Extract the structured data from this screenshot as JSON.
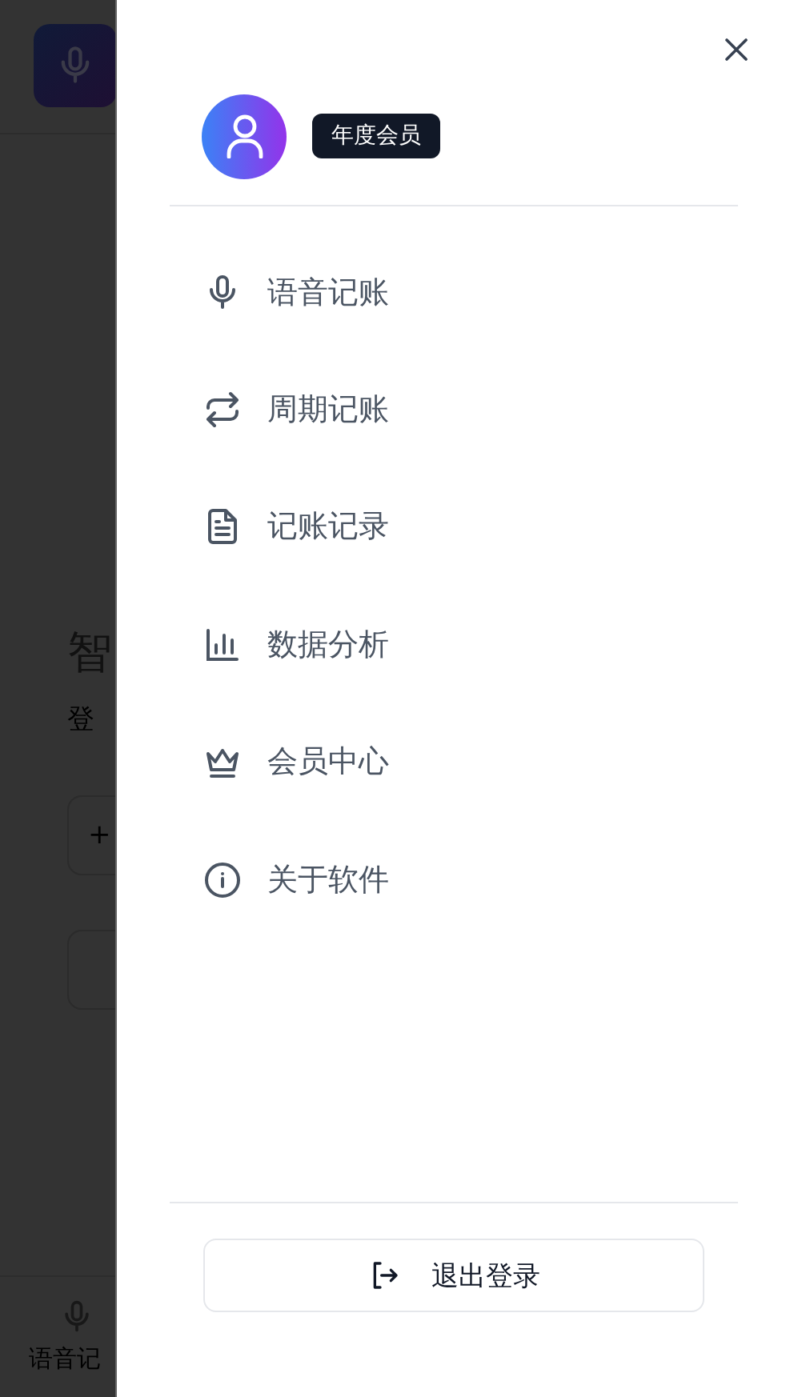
{
  "background": {
    "title": "智",
    "subtitle": "登",
    "phone_field": "+",
    "tab_label": "语音记"
  },
  "drawer": {
    "badge": "年度会员",
    "menu": [
      {
        "kind": "mic",
        "label": "语音记账"
      },
      {
        "kind": "repeat",
        "label": "周期记账"
      },
      {
        "kind": "document",
        "label": "记账记录"
      },
      {
        "kind": "chart",
        "label": "数据分析"
      },
      {
        "kind": "crown",
        "label": "会员中心"
      },
      {
        "kind": "info",
        "label": "关于软件"
      }
    ],
    "logout": "退出登录"
  }
}
